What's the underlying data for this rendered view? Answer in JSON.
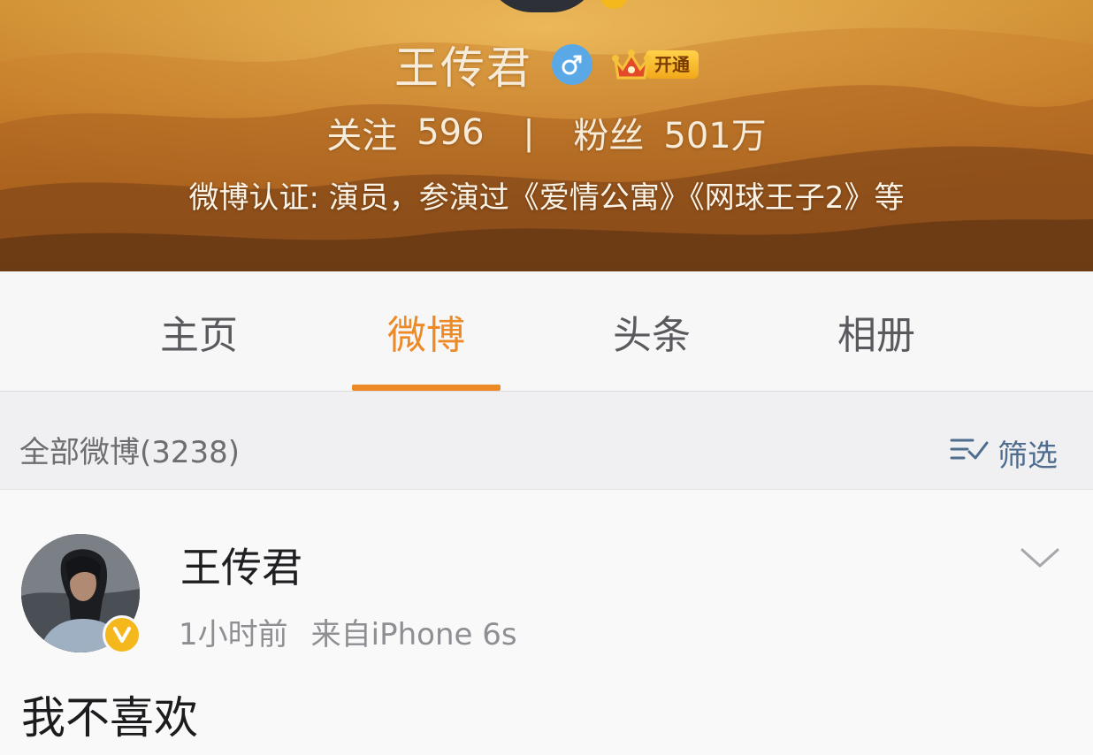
{
  "profile": {
    "name": "王传君",
    "vip_label": "开通",
    "following_label": "关注",
    "following_count": "596",
    "divider": "|",
    "followers_label": "粉丝",
    "followers_count": "501万",
    "verification": "微博认证: 演员，参演过《爱情公寓》《网球王子2》等"
  },
  "tabs": [
    {
      "label": "主页",
      "active": false
    },
    {
      "label": "微博",
      "active": true
    },
    {
      "label": "头条",
      "active": false
    },
    {
      "label": "相册",
      "active": false
    }
  ],
  "filter": {
    "title": "全部微博(3238)",
    "button_label": "筛选"
  },
  "post": {
    "author": "王传君",
    "time": "1小时前",
    "source": "来自iPhone 6s",
    "text": "我不喜欢"
  },
  "colors": {
    "accent": "#ee8a26",
    "filter_link": "#4f6d8f",
    "verified_badge": "#f5b81c",
    "gender_badge": "#5aa9e6"
  },
  "icons": [
    "male-gender-icon",
    "vip-crown-icon",
    "filter-icon",
    "verified-v-icon",
    "chevron-down-icon"
  ]
}
